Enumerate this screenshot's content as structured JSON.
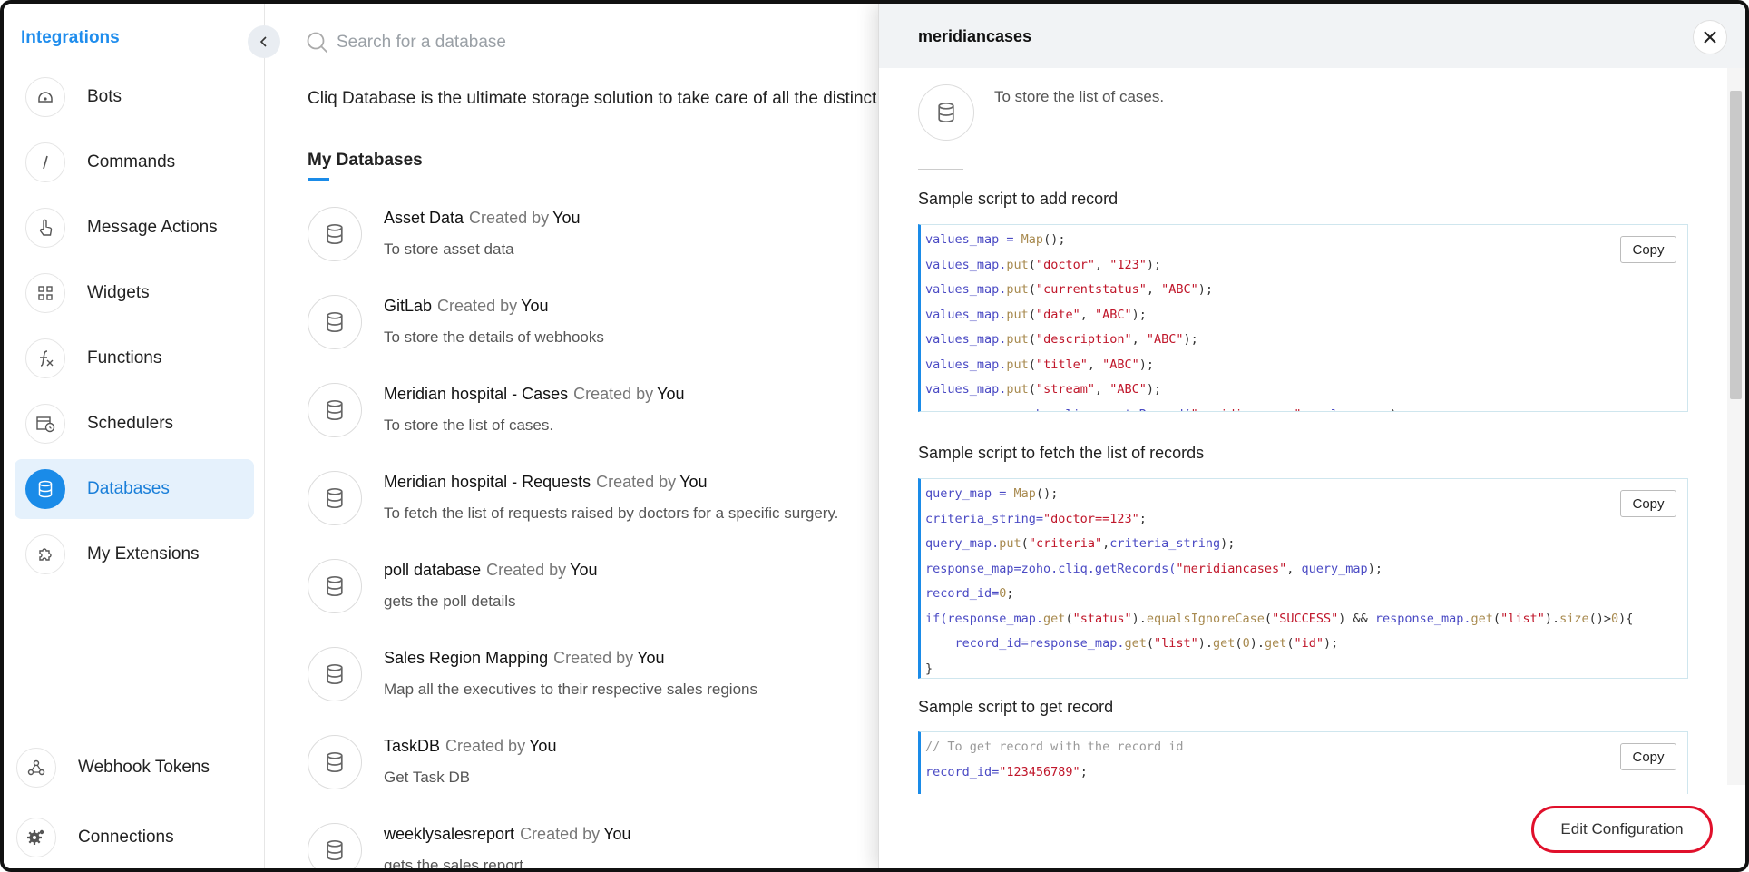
{
  "sidebar": {
    "title": "Integrations",
    "items": [
      {
        "label": "Bots",
        "icon": "bot-icon"
      },
      {
        "label": "Commands",
        "icon": "slash-icon"
      },
      {
        "label": "Message Actions",
        "icon": "hand-pointer-icon"
      },
      {
        "label": "Widgets",
        "icon": "grid-icon"
      },
      {
        "label": "Functions",
        "icon": "function-icon"
      },
      {
        "label": "Schedulers",
        "icon": "calendar-clock-icon"
      },
      {
        "label": "Databases",
        "icon": "database-icon",
        "active": true
      },
      {
        "label": "My Extensions",
        "icon": "puzzle-icon"
      }
    ],
    "bottom": [
      {
        "label": "Webhook Tokens",
        "icon": "webhook-icon"
      },
      {
        "label": "Connections",
        "icon": "gear-icon"
      }
    ]
  },
  "main": {
    "search_placeholder": "Search for a database",
    "intro": "Cliq Database is the ultimate storage solution to take care of all the distinct piece",
    "section_title": "My Databases",
    "databases": [
      {
        "name": "Asset Data",
        "created_by": "Created by",
        "owner": "You",
        "description": "To store asset data"
      },
      {
        "name": "GitLab",
        "created_by": "Created by",
        "owner": "You",
        "description": "To store the details of webhooks"
      },
      {
        "name": "Meridian hospital - Cases",
        "created_by": "Created by",
        "owner": "You",
        "description": "To store the list of cases."
      },
      {
        "name": "Meridian hospital - Requests",
        "created_by": "Created by",
        "owner": "You",
        "description": "To fetch the list of requests raised by doctors for a specific surgery."
      },
      {
        "name": "poll database",
        "created_by": "Created by",
        "owner": "You",
        "description": "gets the poll details"
      },
      {
        "name": "Sales Region Mapping",
        "created_by": "Created by",
        "owner": "You",
        "description": "Map all the executives to their respective sales regions"
      },
      {
        "name": "TaskDB",
        "created_by": "Created by",
        "owner": "You",
        "description": "Get Task DB"
      },
      {
        "name": "weeklysalesreport",
        "created_by": "Created by",
        "owner": "You",
        "description": "gets the sales report"
      }
    ]
  },
  "panel": {
    "title": "meridiancases",
    "description": "To store the list of cases.",
    "copy_label": "Copy",
    "add_record_title": "Sample script to add record",
    "fetch_title": "Sample script to fetch the list of records",
    "get_record_title": "Sample script to get record",
    "edit_config_label": "Edit Configuration"
  },
  "colors": {
    "accent": "#1a8be8",
    "highlight_ring": "#e0102b",
    "code_string": "#c0162a",
    "code_variable": "#4a4ac4"
  }
}
